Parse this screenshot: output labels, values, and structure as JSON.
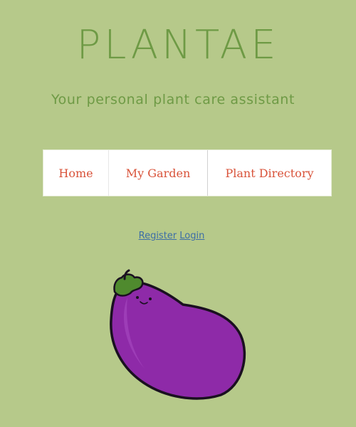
{
  "brand": {
    "title": "PLANTAE",
    "tagline": "Your personal plant care assistant"
  },
  "nav": {
    "items": [
      {
        "label": "Home"
      },
      {
        "label": "My Garden"
      },
      {
        "label": "Plant Directory"
      }
    ]
  },
  "auth": {
    "register_label": "Register",
    "login_label": "Login"
  },
  "colors": {
    "background": "#b6c98a",
    "brand_green": "#6e9a45",
    "nav_text": "#d9533a",
    "link": "#3d6ea6",
    "eggplant_purple": "#8e2aa8"
  },
  "illustration": {
    "icon": "eggplant-mascot"
  }
}
